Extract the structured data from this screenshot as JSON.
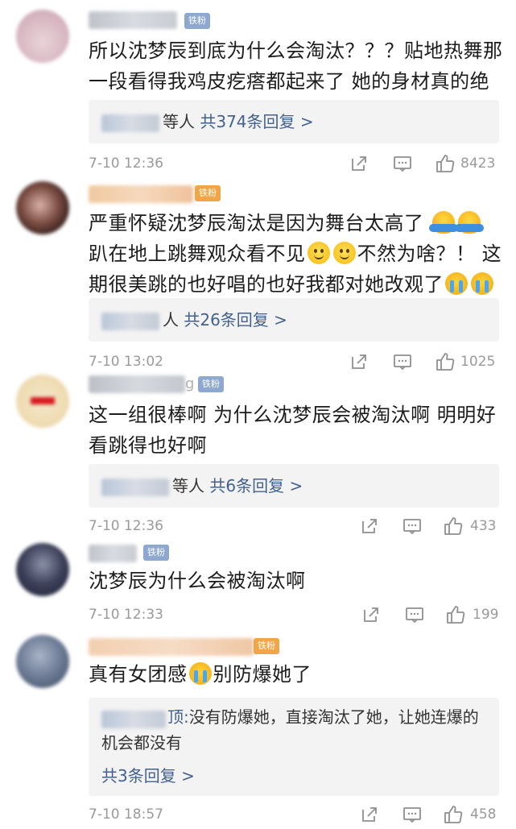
{
  "comments": [
    {
      "badge": "铁粉",
      "text": "所以沈梦辰到底为什么会淘汰？？？贴地热舞那一段看得我鸡皮疙瘩都起来了 她的身材真的绝了",
      "replies_suffix": "等人",
      "replies_count": "共374条回复 >",
      "time": "7-10 12:36",
      "likes": "8423"
    },
    {
      "badge": "铁粉",
      "text_a": "严重怀疑沈梦辰淘汰是因为舞台太高了",
      "text_b": "趴在地上跳舞观众看不见",
      "text_c": "不然为啥？！ 这期很美跳的也好唱的也好我都对她改观了",
      "replies_suffix": "人",
      "replies_count": "共26条回复 >",
      "time": "7-10 13:02",
      "likes": "1025"
    },
    {
      "badge": "铁粉",
      "username_tail": "g",
      "text": "这一组很棒啊 为什么沈梦辰会被淘汰啊 明明好看跳得也好啊",
      "replies_suffix": "等人",
      "replies_count": "共6条回复 >",
      "time": "7-10 12:36",
      "likes": "433"
    },
    {
      "badge": "铁粉",
      "text": "沈梦辰为什么会被淘汰啊",
      "time": "7-10 12:33",
      "likes": "199"
    },
    {
      "badge": "铁粉",
      "text_a": "真有女团感",
      "text_b": "别防爆她了",
      "reply_author_tail": "顶:",
      "reply_text": "没有防爆她，直接淘汰了她，让她连爆的机会都没有",
      "replies_count": "共3条回复 >",
      "time": "7-10 18:57",
      "likes": "458"
    }
  ],
  "icons": {
    "share": "share-icon",
    "comment": "comment-icon",
    "like": "thumbs-up-icon",
    "cry_emoji": "crying-face-emoji",
    "smile_emoji": "smile-face-emoji",
    "shrug_emoji": "shrug-emoji"
  },
  "colors": {
    "link": "#43618f",
    "meta": "#9a9a9a",
    "badge_blue": "#8fa8cf",
    "badge_orange": "#f0a646",
    "reply_bg": "#f3f3f3"
  }
}
